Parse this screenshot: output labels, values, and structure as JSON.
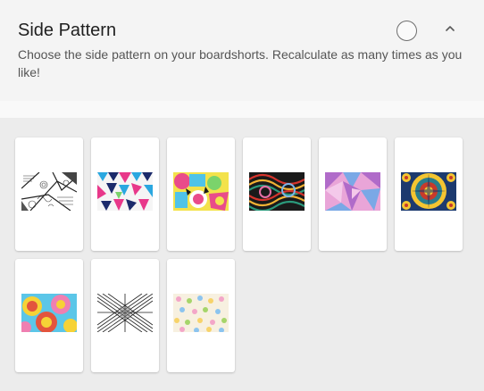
{
  "section": {
    "title": "Side Pattern",
    "description": "Choose the side pattern on your boardshorts. Recalculate as many times as you like!"
  },
  "icons": {
    "status": "empty-circle-icon",
    "collapse": "chevron-up-icon"
  },
  "patterns": [
    {
      "name": "zentangle-mono",
      "colors": [
        "#ffffff",
        "#222222",
        "#888888"
      ]
    },
    {
      "name": "geometric-triangles",
      "colors": [
        "#e8388a",
        "#2aa7e0",
        "#1b2a6b",
        "#f5f5f5"
      ]
    },
    {
      "name": "pop-collage",
      "colors": [
        "#f3e24b",
        "#e94b8a",
        "#4fc3e8",
        "#7bd36b"
      ]
    },
    {
      "name": "psychedelic-swirl",
      "colors": [
        "#1a1a1a",
        "#d6342c",
        "#f2b234",
        "#2b9a7c"
      ]
    },
    {
      "name": "pastel-triangles",
      "colors": [
        "#b06bc9",
        "#7aa8e6",
        "#e9a5d8",
        "#f4c9ea"
      ]
    },
    {
      "name": "mandala-kaleidoscope",
      "colors": [
        "#f4c531",
        "#2a7d8c",
        "#c73a2b",
        "#1c3a6e"
      ]
    },
    {
      "name": "rainbow-floral",
      "colors": [
        "#f6d236",
        "#e3543d",
        "#5bc6e8",
        "#ef7fb1"
      ]
    },
    {
      "name": "mono-weave",
      "colors": [
        "#ffffff",
        "#1e1e1e",
        "#8a8a8a"
      ]
    },
    {
      "name": "pastel-floral-dots",
      "colors": [
        "#f7f0e0",
        "#f3a6c8",
        "#a6d56a",
        "#8cc4ef",
        "#f7d36a"
      ]
    }
  ]
}
